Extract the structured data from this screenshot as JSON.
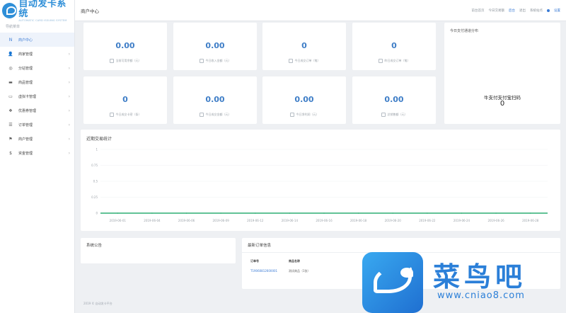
{
  "brand": {
    "title": "自动发卡系统",
    "subtitle": "AUTOMATIC CARD ISSUING SYSTEM"
  },
  "sidebar": {
    "caption": "导航菜单",
    "items": [
      {
        "label": "商户中心",
        "icon": "home-icon",
        "glyph": "N",
        "active": true
      },
      {
        "label": "商家管理",
        "icon": "user-icon",
        "glyph": "👤",
        "active": false
      },
      {
        "label": "分站管理",
        "icon": "globe-icon",
        "glyph": "◎",
        "active": false
      },
      {
        "label": "商品管理",
        "icon": "shop-icon",
        "glyph": "▬",
        "active": false
      },
      {
        "label": "虚拟卡管理",
        "icon": "card-icon",
        "glyph": "▭",
        "active": false
      },
      {
        "label": "优惠券管理",
        "icon": "coupon-icon",
        "glyph": "❖",
        "active": false
      },
      {
        "label": "订单管理",
        "icon": "list-icon",
        "glyph": "☰",
        "active": false
      },
      {
        "label": "商户管理",
        "icon": "merchant-icon",
        "glyph": "⚑",
        "active": false
      },
      {
        "label": "资金管理",
        "icon": "money-icon",
        "glyph": "$",
        "active": false
      }
    ]
  },
  "topbar": {
    "title": "商户中心",
    "links": [
      "前台首页",
      "今日交易额",
      "后台",
      "退出"
    ],
    "account": "系统站点",
    "settings": "设置"
  },
  "stats": [
    {
      "value": "0.00",
      "label": "当前可用余额（元）"
    },
    {
      "value": "0.00",
      "label": "今日收入金额（元）"
    },
    {
      "value": "0",
      "label": "今日成交订单（笔）"
    },
    {
      "value": "0",
      "label": "昨日成交订单（笔）"
    },
    {
      "value": "0",
      "label": "今日成交卡密（条）"
    },
    {
      "value": "0.00",
      "label": "今日成交金额（元）"
    },
    {
      "value": "0.00",
      "label": "今日净利润（元）"
    },
    {
      "value": "0.00",
      "label": "总销售额（元）"
    }
  ],
  "pay_panel": {
    "title": "今日支付通道分布",
    "channel": "牛支付支付宝扫码",
    "value": "0"
  },
  "chart_data": {
    "type": "line",
    "title": "近期交易统计",
    "x": [
      "2019-06-01",
      "2019-06-04",
      "2019-06-06",
      "2019-06-09",
      "2019-06-12",
      "2019-06-14",
      "2019-06-16",
      "2019-06-18",
      "2019-06-20",
      "2019-06-22",
      "2019-06-24",
      "2019-06-26",
      "2019-06-28"
    ],
    "yticks": [
      "1",
      "0.75",
      "0.5",
      "0.25",
      "0"
    ],
    "ylim": [
      0,
      1
    ],
    "series": [
      {
        "values": [
          0,
          0,
          0,
          0,
          0,
          0,
          0,
          0,
          0,
          0,
          0,
          0,
          0
        ],
        "color": "#2fae74"
      }
    ],
    "grid": true
  },
  "announce": {
    "title": "系统公告"
  },
  "orders": {
    "title": "最新订单信息",
    "headers": [
      "订单号",
      "商品名称"
    ],
    "rows": [
      [
        "T19060812600001",
        "测试商品（1张）"
      ]
    ]
  },
  "footer": "2019 © 自动发卡平台",
  "watermark": {
    "name": "菜鸟吧",
    "url": "www.cniao8.com"
  },
  "colors": {
    "accent": "#3a7bd5",
    "line": "#2fae74"
  }
}
